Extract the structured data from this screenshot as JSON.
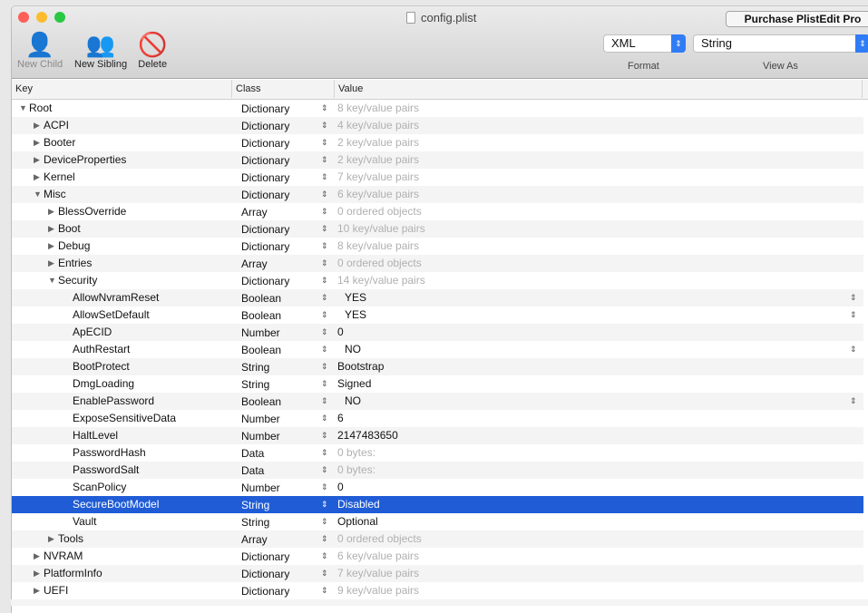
{
  "window": {
    "title": "config.plist"
  },
  "toolbar": {
    "new_child": "New Child",
    "new_sibling": "New Sibling",
    "delete": "Delete",
    "purchase": "Purchase PlistEdit Pro",
    "format_value": "XML",
    "format_label": "Format",
    "view_as_value": "String",
    "view_as_label": "View As"
  },
  "columns": {
    "key": "Key",
    "class": "Class",
    "value": "Value"
  },
  "colors": {
    "selection": "#1f5cd6",
    "popup_accent": "#2f7cf6",
    "placeholder": "#b0b0b0"
  },
  "rows": [
    {
      "key": "Root",
      "level": 0,
      "tri": "open",
      "class": "Dictionary",
      "value": "8 key/value pairs",
      "ph": true
    },
    {
      "key": "ACPI",
      "level": 1,
      "tri": "closed",
      "class": "Dictionary",
      "value": "4 key/value pairs",
      "ph": true
    },
    {
      "key": "Booter",
      "level": 1,
      "tri": "closed",
      "class": "Dictionary",
      "value": "2 key/value pairs",
      "ph": true
    },
    {
      "key": "DeviceProperties",
      "level": 1,
      "tri": "closed",
      "class": "Dictionary",
      "value": "2 key/value pairs",
      "ph": true
    },
    {
      "key": "Kernel",
      "level": 1,
      "tri": "closed",
      "class": "Dictionary",
      "value": "7 key/value pairs",
      "ph": true
    },
    {
      "key": "Misc",
      "level": 1,
      "tri": "open",
      "class": "Dictionary",
      "value": "6 key/value pairs",
      "ph": true
    },
    {
      "key": "BlessOverride",
      "level": 2,
      "tri": "closed",
      "class": "Array",
      "value": "0 ordered objects",
      "ph": true
    },
    {
      "key": "Boot",
      "level": 2,
      "tri": "closed",
      "class": "Dictionary",
      "value": "10 key/value pairs",
      "ph": true
    },
    {
      "key": "Debug",
      "level": 2,
      "tri": "closed",
      "class": "Dictionary",
      "value": "8 key/value pairs",
      "ph": true
    },
    {
      "key": "Entries",
      "level": 2,
      "tri": "closed",
      "class": "Array",
      "value": "0 ordered objects",
      "ph": true
    },
    {
      "key": "Security",
      "level": 2,
      "tri": "open",
      "class": "Dictionary",
      "value": "14 key/value pairs",
      "ph": true
    },
    {
      "key": "AllowNvramReset",
      "level": 3,
      "class": "Boolean",
      "value": "YES",
      "bool": true
    },
    {
      "key": "AllowSetDefault",
      "level": 3,
      "class": "Boolean",
      "value": "YES",
      "bool": true
    },
    {
      "key": "ApECID",
      "level": 3,
      "class": "Number",
      "value": "0"
    },
    {
      "key": "AuthRestart",
      "level": 3,
      "class": "Boolean",
      "value": "NO",
      "bool": true
    },
    {
      "key": "BootProtect",
      "level": 3,
      "class": "String",
      "value": "Bootstrap"
    },
    {
      "key": "DmgLoading",
      "level": 3,
      "class": "String",
      "value": "Signed"
    },
    {
      "key": "EnablePassword",
      "level": 3,
      "class": "Boolean",
      "value": "NO",
      "bool": true
    },
    {
      "key": "ExposeSensitiveData",
      "level": 3,
      "class": "Number",
      "value": "6"
    },
    {
      "key": "HaltLevel",
      "level": 3,
      "class": "Number",
      "value": "2147483650"
    },
    {
      "key": "PasswordHash",
      "level": 3,
      "class": "Data",
      "value": "0 bytes:",
      "ph": true
    },
    {
      "key": "PasswordSalt",
      "level": 3,
      "class": "Data",
      "value": "0 bytes:",
      "ph": true
    },
    {
      "key": "ScanPolicy",
      "level": 3,
      "class": "Number",
      "value": "0"
    },
    {
      "key": "SecureBootModel",
      "level": 3,
      "class": "String",
      "value": "Disabled",
      "selected": true
    },
    {
      "key": "Vault",
      "level": 3,
      "class": "String",
      "value": "Optional"
    },
    {
      "key": "Tools",
      "level": 2,
      "tri": "closed",
      "class": "Array",
      "value": "0 ordered objects",
      "ph": true
    },
    {
      "key": "NVRAM",
      "level": 1,
      "tri": "closed",
      "class": "Dictionary",
      "value": "6 key/value pairs",
      "ph": true
    },
    {
      "key": "PlatformInfo",
      "level": 1,
      "tri": "closed",
      "class": "Dictionary",
      "value": "7 key/value pairs",
      "ph": true
    },
    {
      "key": "UEFI",
      "level": 1,
      "tri": "closed",
      "class": "Dictionary",
      "value": "9 key/value pairs",
      "ph": true
    }
  ]
}
